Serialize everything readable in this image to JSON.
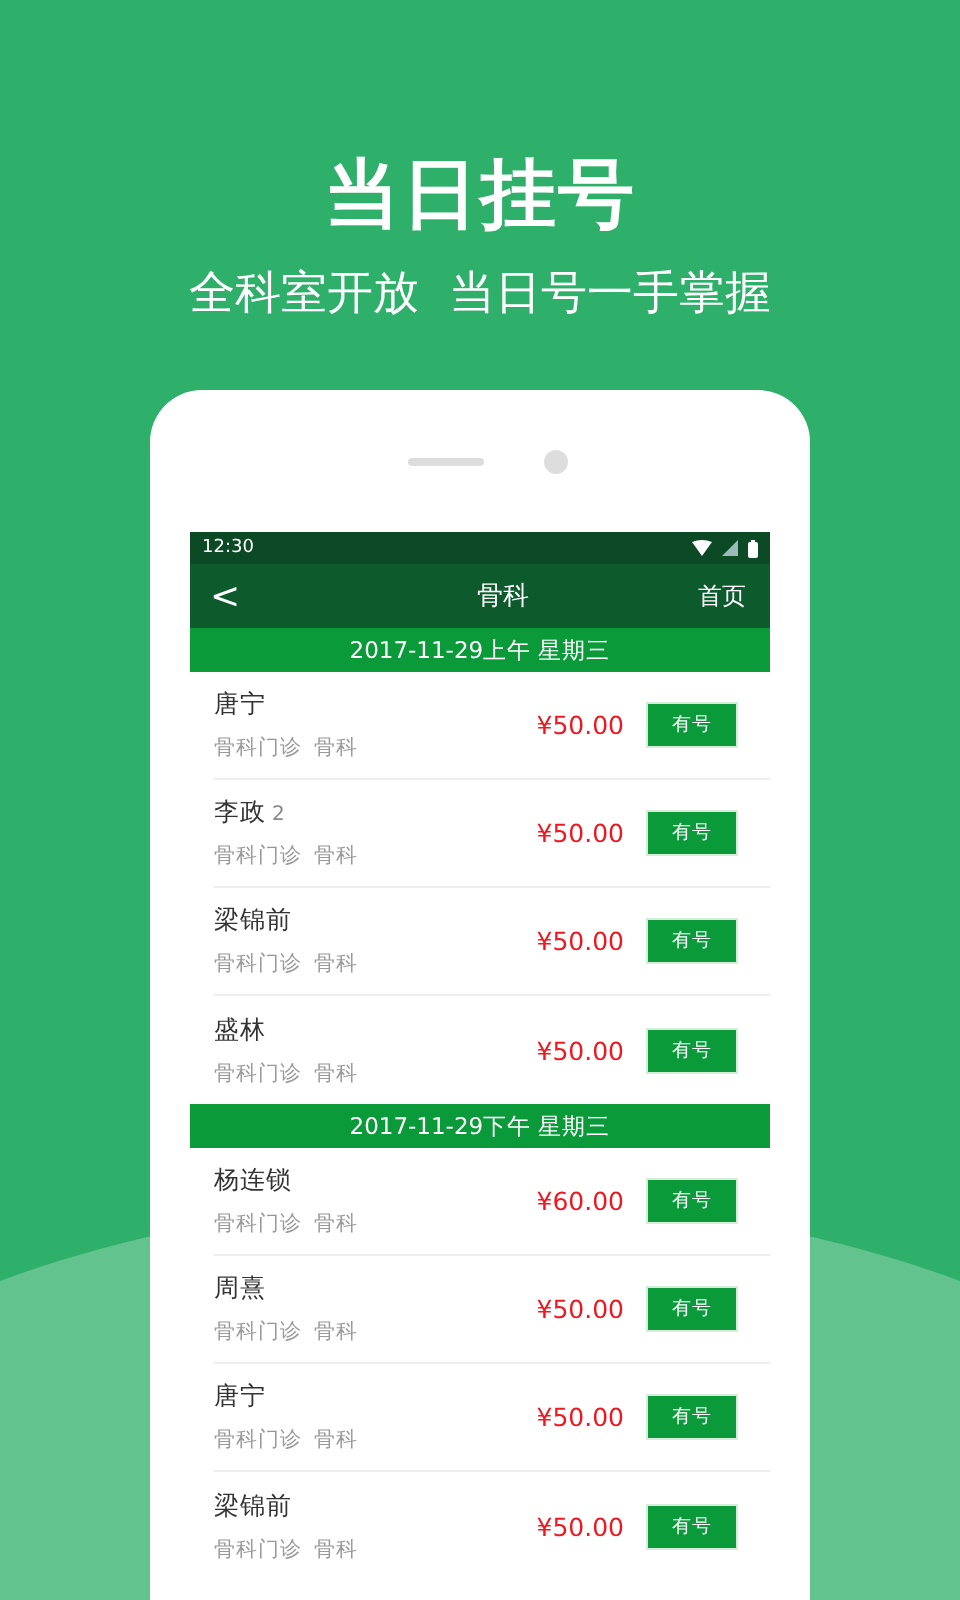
{
  "headline": "当日挂号",
  "subheadline": "全科室开放  当日号一手掌握",
  "status_bar": {
    "time": "12:30"
  },
  "nav": {
    "back": "<",
    "title": "骨科",
    "right": "首页"
  },
  "sections": [
    {
      "header": "2017-11-29上午 星期三",
      "doctors": [
        {
          "name": "唐宁",
          "clinic": "骨科门诊",
          "department": "骨科",
          "price": "¥50.00",
          "button": "有号"
        },
        {
          "name": "李政",
          "count": "2",
          "clinic": "骨科门诊",
          "department": "骨科",
          "price": "¥50.00",
          "button": "有号"
        },
        {
          "name": "梁锦前",
          "clinic": "骨科门诊",
          "department": "骨科",
          "price": "¥50.00",
          "button": "有号"
        },
        {
          "name": "盛林",
          "clinic": "骨科门诊",
          "department": "骨科",
          "price": "¥50.00",
          "button": "有号"
        }
      ]
    },
    {
      "header": "2017-11-29下午 星期三",
      "doctors": [
        {
          "name": "杨连锁",
          "clinic": "骨科门诊",
          "department": "骨科",
          "price": "¥60.00",
          "button": "有号"
        },
        {
          "name": "周熹",
          "clinic": "骨科门诊",
          "department": "骨科",
          "price": "¥50.00",
          "button": "有号"
        },
        {
          "name": "唐宁",
          "clinic": "骨科门诊",
          "department": "骨科",
          "price": "¥50.00",
          "button": "有号"
        },
        {
          "name": "梁锦前",
          "clinic": "骨科门诊",
          "department": "骨科",
          "price": "¥50.00",
          "button": "有号"
        }
      ]
    }
  ]
}
